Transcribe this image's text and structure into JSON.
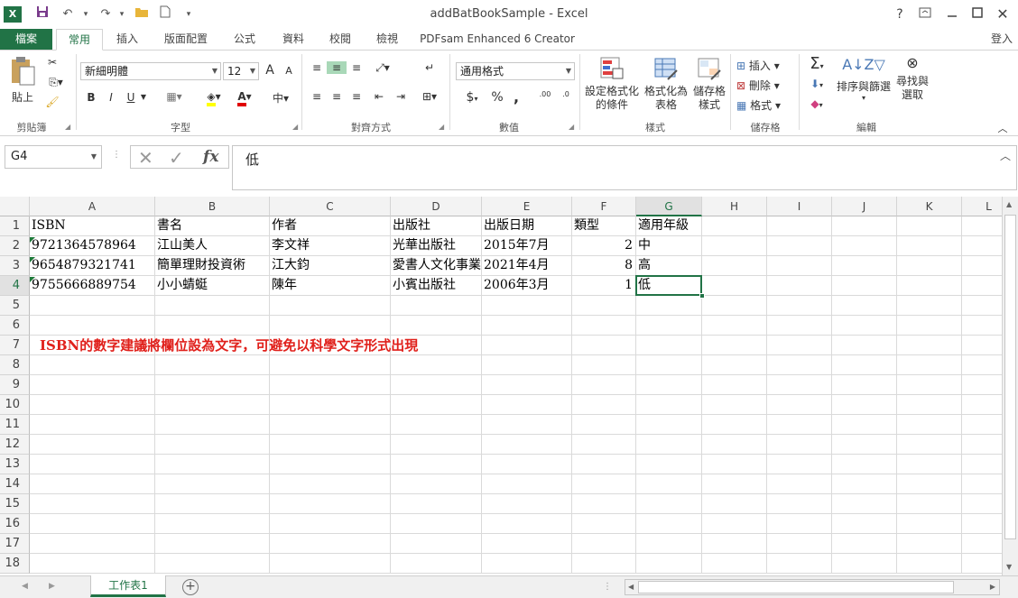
{
  "window": {
    "title": "addBatBookSample - Excel",
    "signin": "登入"
  },
  "qat": {
    "save": "💾",
    "undo": "↶",
    "redo": "↷",
    "open": "📂",
    "new": "🗋",
    "more": "▾"
  },
  "tabs": [
    "檔案",
    "常用",
    "插入",
    "版面配置",
    "公式",
    "資料",
    "校閱",
    "檢視",
    "PDFsam Enhanced 6 Creator"
  ],
  "ribbon": {
    "clipboard": {
      "paste": "貼上",
      "label": "剪貼簿"
    },
    "font": {
      "name": "新細明體",
      "size": "12",
      "bold": "B",
      "italic": "I",
      "underline": "U",
      "grow": "A",
      "shrink": "A",
      "label": "字型"
    },
    "alignment": {
      "label": "對齊方式"
    },
    "number": {
      "format": "通用格式",
      "currency": "$",
      "percent": "%",
      "comma": ",",
      "inc_decimal": ".00",
      "dec_decimal": ".0",
      "label": "數值"
    },
    "styles": {
      "conditional": "設定格式化\n的條件",
      "table": "格式化為\n表格",
      "cell": "儲存格\n樣式",
      "label": "樣式"
    },
    "cells": {
      "insert": "插入",
      "delete": "刪除",
      "format": "格式",
      "label": "儲存格"
    },
    "editing": {
      "sort": "排序與篩選",
      "find": "尋找與\n選取",
      "label": "編輯"
    }
  },
  "formula_bar": {
    "name_box": "G4",
    "fx": "fx",
    "value": "低"
  },
  "columns": [
    "A",
    "B",
    "C",
    "D",
    "E",
    "F",
    "G",
    "H",
    "I",
    "J",
    "K",
    "L"
  ],
  "rows": [
    "1",
    "2",
    "3",
    "4",
    "5",
    "6",
    "7",
    "8",
    "9",
    "10",
    "11",
    "12",
    "13",
    "14",
    "15",
    "16",
    "17",
    "18"
  ],
  "cells": {
    "A1": "ISBN",
    "B1": "書名",
    "C1": "作者",
    "D1": "出版社",
    "E1": "出版日期",
    "F1": "類型",
    "G1": "適用年級",
    "A2": "9721364578964",
    "B2": "江山美人",
    "C2": "李文祥",
    "D2": "光華出版社",
    "E2": "2015年7月",
    "F2": "2",
    "G2": "中",
    "A3": "9654879321741",
    "B3": "簡單理財投資術",
    "C3": "江大鈞",
    "D3": "愛書人文化事業",
    "E3": "2021年4月",
    "F3": "8",
    "G3": "高",
    "A4": "9755666889754",
    "B4": "小小蜻蜓",
    "C4": "陳年",
    "D4": "小賓出版社",
    "E4": "2006年3月",
    "F4": "1",
    "G4": "低"
  },
  "note": "ISBN的數字建議將欄位設為文字，可避免以科學文字形式出現",
  "colors": {
    "accent": "#217346",
    "note": "#e0201b"
  },
  "sheet_tab": "工作表1"
}
